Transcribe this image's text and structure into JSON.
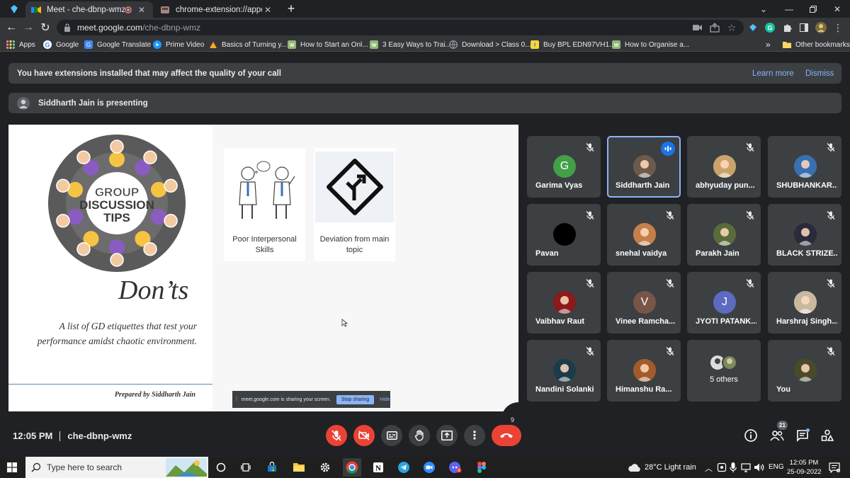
{
  "browser": {
    "tabs": [
      {
        "title": "Meet - che-dbnp-wmz",
        "active": true
      },
      {
        "title": "chrome-extension://appcnhiefcic",
        "active": false
      }
    ],
    "url_host": "meet.google.com",
    "url_path": "/che-dbnp-wmz",
    "bookmarks": [
      "Apps",
      "Google",
      "Google Translate",
      "Prime Video",
      "Basics of Turning y...",
      "How to Start an Onl...",
      "3 Easy Ways to Trai...",
      "Download > Class 0...",
      "Buy BPL EDN97VH1...",
      "How to Organise a..."
    ],
    "bookmarks_overflow": "»",
    "other_bookmarks": "Other bookmarks"
  },
  "meet": {
    "ext_banner": {
      "message": "You have extensions installed that may affect the quality of your call",
      "learn_more": "Learn more",
      "dismiss": "Dismiss"
    },
    "presenting_text": "Siddharth Jain is presenting",
    "slide": {
      "circle_title": [
        "GROUP",
        "DISCUSSION",
        "TIPS"
      ],
      "heading": "Don’ts",
      "description": "A list of GD etiquettes that test your performance amidst chaotic environment.",
      "author": "Prepared by Siddharth Jain",
      "cards": [
        {
          "label": "Poor Interpersonal Skills"
        },
        {
          "label": "Deviation from main topic"
        }
      ],
      "share_notice": "meet.google.com is sharing your screen.",
      "stop_sharing": "Stop sharing",
      "hide": "Hide",
      "page_number": "9"
    },
    "participants": [
      {
        "name": "Garima Vyas",
        "initial": "G",
        "color": "#43a047"
      },
      {
        "name": "Siddharth Jain",
        "speaking": true
      },
      {
        "name": "abhyuday pun..."
      },
      {
        "name": "SHUBHANKAR..."
      },
      {
        "name": "Pavan"
      },
      {
        "name": "snehal vaidya"
      },
      {
        "name": "Parakh Jain"
      },
      {
        "name": "BLACK STRIZE..."
      },
      {
        "name": "Vaibhav Raut"
      },
      {
        "name": "Vinee Ramcha...",
        "initial": "V",
        "color": "#795548"
      },
      {
        "name": "JYOTI PATANK...",
        "initial": "J",
        "color": "#5c6bc0"
      },
      {
        "name": "Harshraj Singh..."
      },
      {
        "name": "Nandini Solanki"
      },
      {
        "name": "Himanshu Ra..."
      },
      {
        "name": "5 others"
      },
      {
        "name": "You"
      }
    ],
    "footer": {
      "time": "12:05 PM",
      "meeting_code": "che-dbnp-wmz",
      "people_count": "21"
    }
  },
  "taskbar": {
    "search_placeholder": "Type here to search",
    "weather": "28°C  Light rain",
    "lang": "ENG",
    "time": "12:05 PM",
    "date": "25-09-2022"
  }
}
